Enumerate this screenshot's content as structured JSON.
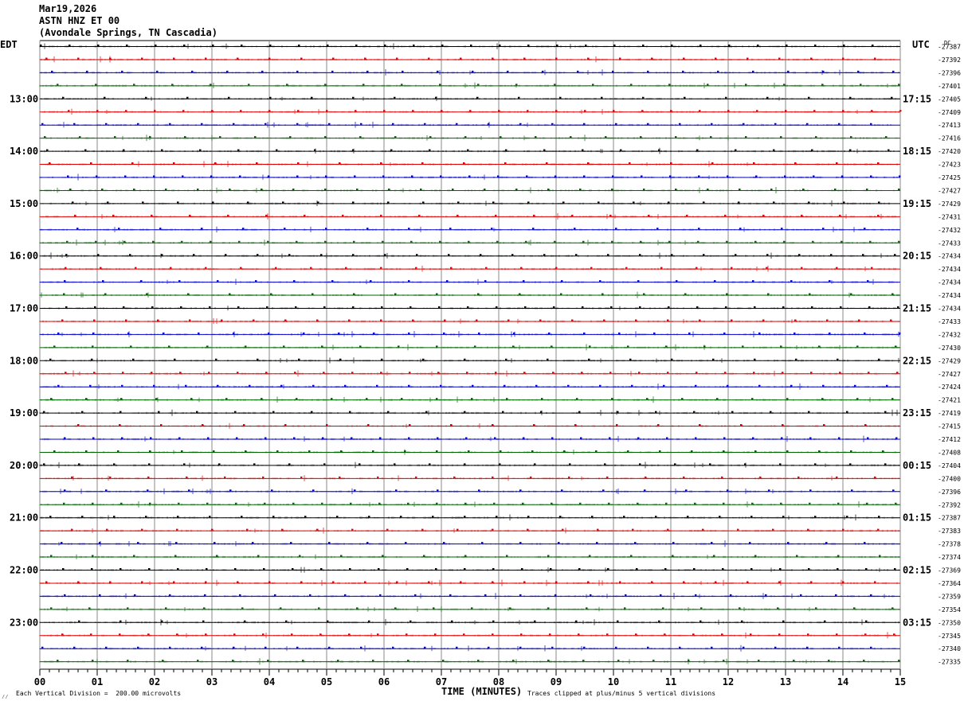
{
  "header": {
    "date": "Mar19,2026",
    "station": "ASTN HNZ ET 00",
    "location": "(Avondale Springs, TN Cascadia)"
  },
  "chart_data": {
    "type": "line",
    "title": "",
    "xlabel": "TIME (MINUTES)",
    "x_ticks": [
      "00",
      "01",
      "02",
      "03",
      "04",
      "05",
      "06",
      "07",
      "08",
      "09",
      "10",
      "11",
      "12",
      "13",
      "14",
      "15"
    ],
    "xlim": [
      0,
      15
    ],
    "left_axis_title": "EDT",
    "right_axis_title": "UTC",
    "offset_header": "DC",
    "left_hour_labels": [
      "13:00",
      "14:00",
      "15:00",
      "16:00",
      "17:00",
      "18:00",
      "19:00",
      "20:00",
      "21:00",
      "22:00",
      "23:00"
    ],
    "right_hour_labels": [
      "17:15",
      "18:15",
      "19:15",
      "20:15",
      "21:15",
      "22:15",
      "23:15",
      "00:15",
      "01:15",
      "02:15",
      "03:15"
    ],
    "trace_colors": [
      "#000000",
      "#e00000",
      "#0000c8",
      "#006400"
    ],
    "trace_offsets": [
      -27387,
      -27392,
      -27396,
      -27401,
      -27405,
      -27409,
      -27413,
      -27416,
      -27420,
      -27423,
      -27425,
      -27427,
      -27429,
      -27431,
      -27432,
      -27433,
      -27434,
      -27434,
      -27434,
      -27434,
      -27434,
      -27433,
      -27432,
      -27430,
      -27429,
      -27427,
      -27424,
      -27421,
      -27419,
      -27415,
      -27412,
      -27408,
      -27404,
      -27400,
      -27396,
      -27392,
      -27387,
      -27383,
      -27378,
      -27374,
      -27369,
      -27364,
      -27359,
      -27354,
      -27350,
      -27345,
      -27340,
      -27335
    ]
  },
  "footer": {
    "scale_note": "Each Vertical Division =  200.00 microvolts",
    "clip_note": "Traces clipped at plus/minus 5 vertical divisions",
    "corner_mark": "⁄⁄"
  }
}
